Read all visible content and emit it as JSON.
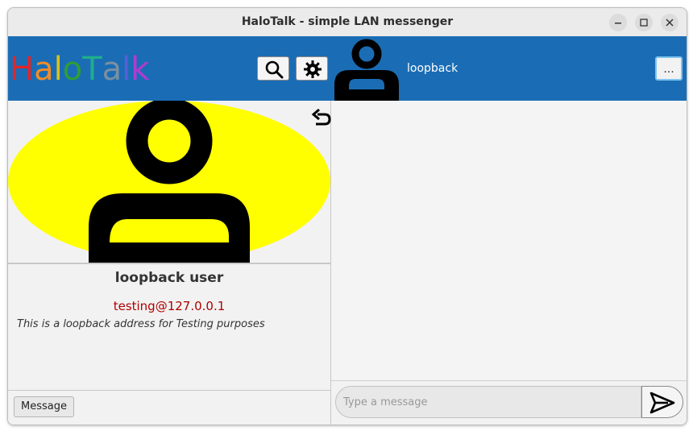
{
  "window": {
    "title": "HaloTalk - simple LAN messenger",
    "controls": [
      "minimize-icon",
      "maximize-icon",
      "close-icon"
    ]
  },
  "header": {
    "logo_letters": [
      {
        "ch": "H",
        "color": "#e0262a"
      },
      {
        "ch": "a",
        "color": "#f28c28"
      },
      {
        "ch": "l",
        "color": "#d9c01e"
      },
      {
        "ch": "o",
        "color": "#2f9e33"
      },
      {
        "ch": "T",
        "color": "#1fae8c"
      },
      {
        "ch": "a",
        "color": "#7b8fa1"
      },
      {
        "ch": "l",
        "color": "#5a5fd6"
      },
      {
        "ch": "k",
        "color": "#b23ad1"
      }
    ],
    "search_icon": "search-icon",
    "settings_icon": "gear-icon",
    "contact_name": "loopback",
    "more_label": "..."
  },
  "profile": {
    "name": "loopback user",
    "address": "testing@127.0.0.1",
    "description": "This is a loopback address for Testing purposes",
    "avatar_bg": "#ffff00"
  },
  "left_bottom": {
    "message_button": "Message"
  },
  "composer": {
    "placeholder": "Type a message",
    "send_icon": "send-icon"
  },
  "colors": {
    "accent": "#1a6db5",
    "address": "#b00000"
  }
}
